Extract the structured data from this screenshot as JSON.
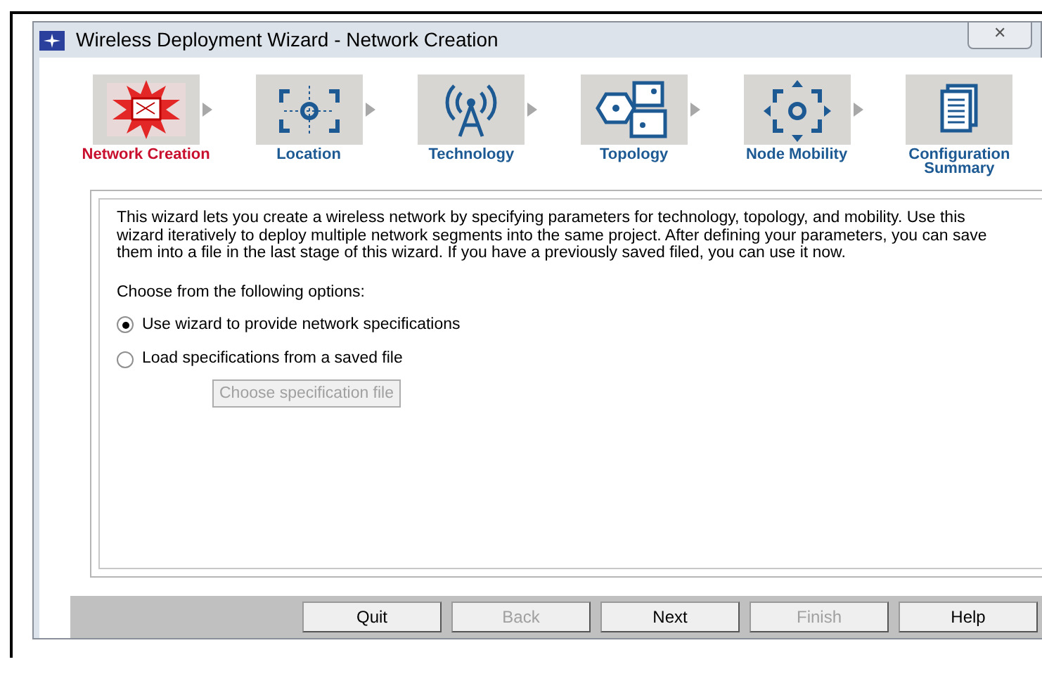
{
  "window": {
    "title": "Wireless Deployment Wizard - Network Creation",
    "close": "✕"
  },
  "steps": [
    {
      "kind": "network",
      "label": "Network Creation",
      "selected": true
    },
    {
      "kind": "location",
      "label": "Location",
      "selected": false
    },
    {
      "kind": "technology",
      "label": "Technology",
      "selected": false
    },
    {
      "kind": "topology",
      "label": "Topology",
      "selected": false
    },
    {
      "kind": "mobility",
      "label": "Node Mobility",
      "selected": false
    },
    {
      "kind": "summary",
      "label": "Configuration Summary",
      "selected": false
    }
  ],
  "intro": "This wizard lets you create a wireless network by specifying parameters for technology, topology, and mobility. Use this wizard iteratively to deploy multiple network segments into the same project. After defining your parameters, you can save them into a file in the last stage of this wizard. If you have a previously saved filed, you can use it now.",
  "options_label": "Choose from the following options:",
  "options": [
    {
      "label": "Use wizard to provide network specifications",
      "selected": true
    },
    {
      "label": "Load specifications from a saved file",
      "selected": false
    }
  ],
  "file_button": {
    "label": "Choose specification file",
    "disabled": true
  },
  "buttons": [
    {
      "label": "Quit",
      "disabled": false
    },
    {
      "label": "Back",
      "disabled": true
    },
    {
      "label": "Next",
      "disabled": false
    },
    {
      "label": "Finish",
      "disabled": true
    },
    {
      "label": "Help",
      "disabled": false
    }
  ]
}
